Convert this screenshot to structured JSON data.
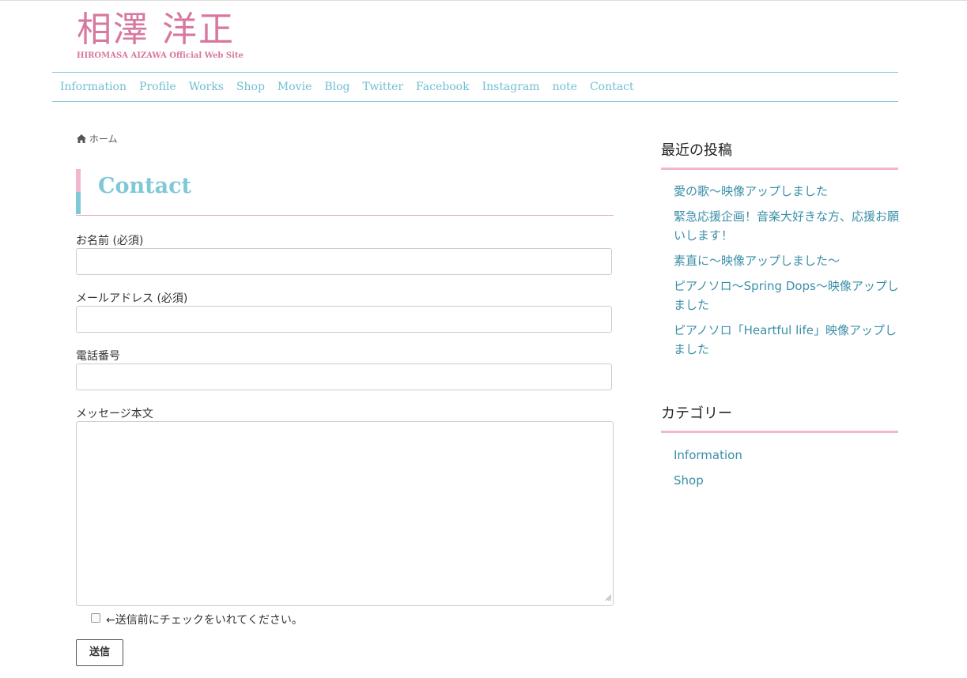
{
  "site": {
    "logo_main": "相澤 洋正",
    "logo_sub": "HIROMASA AIZAWA Official Web Site"
  },
  "nav": {
    "items": [
      {
        "label": "Information"
      },
      {
        "label": "Profile"
      },
      {
        "label": "Works"
      },
      {
        "label": "Shop"
      },
      {
        "label": "Movie"
      },
      {
        "label": "Blog"
      },
      {
        "label": "Twitter"
      },
      {
        "label": "Facebook"
      },
      {
        "label": "Instagram"
      },
      {
        "label": "note"
      },
      {
        "label": "Contact"
      }
    ]
  },
  "breadcrumb": {
    "home_label": "ホーム",
    "icon": "home-icon"
  },
  "page": {
    "title": "Contact"
  },
  "form": {
    "name_label": "お名前 (必須)",
    "email_label": "メールアドレス (必須)",
    "phone_label": "電話番号",
    "message_label": "メッセージ本文",
    "checkbox_label": "←送信前にチェックをいれてください。",
    "submit_label": "送信"
  },
  "sidebar": {
    "recent_heading": "最近の投稿",
    "recent_posts": [
      {
        "label": "愛の歌〜映像アップしました"
      },
      {
        "label": "緊急応援企画！音楽大好きな方、応援お願いします！"
      },
      {
        "label": "素直に〜映像アップしました〜"
      },
      {
        "label": "ピアノソロ〜Spring Dops〜映像アップしました"
      },
      {
        "label": "ピアノソロ「Heartful life」映像アップしました"
      }
    ],
    "category_heading": "カテゴリー",
    "categories": [
      {
        "label": "Information"
      },
      {
        "label": "Shop"
      }
    ]
  },
  "colors": {
    "brand_pink": "#d6789f",
    "accent_blue": "#7fc8d8",
    "link_blue": "#3a8fa8",
    "accent_pink": "#f3b6cf"
  }
}
